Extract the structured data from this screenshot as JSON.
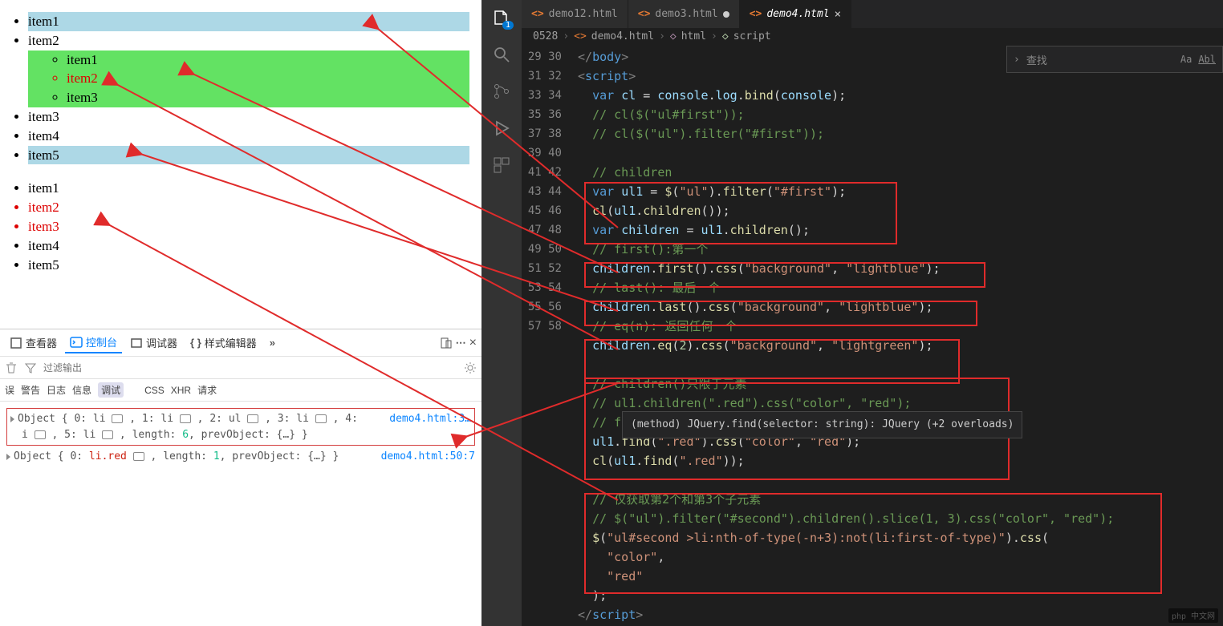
{
  "preview": {
    "list1_items": [
      "item1",
      "item2",
      "item3",
      "item4",
      "item5"
    ],
    "nested_items": [
      "item1",
      "item2",
      "item3"
    ],
    "list2_items": [
      "item1",
      "item2",
      "item3",
      "item4",
      "item5"
    ]
  },
  "devtools": {
    "tabs": {
      "inspector": "查看器",
      "console": "控制台",
      "debugger": "调试器",
      "style": "样式编辑器"
    },
    "filter_placeholder": "过滤输出",
    "sub_left": "误",
    "sub": [
      "警告",
      "日志",
      "信息",
      "调试"
    ],
    "sub2": [
      "CSS",
      "XHR",
      "请求"
    ],
    "obj1_full": "Object { 0: li ▢ , 1: li ▢ , 2: ul ▢ , 3: li ▢ , 4:",
    "obj1_wrap": "i ▢ , 5: li ▢ , length: 6, prevObject: {…} }",
    "obj1_link": "demo4.html:3…",
    "obj2": "Object { 0: li.red ▢ , length: 1, prevObject: {…} }",
    "obj2_link": "demo4.html:50:7"
  },
  "vscode": {
    "badge": "1",
    "tabs": [
      {
        "label": "demo12.html",
        "active": false,
        "dirty": false
      },
      {
        "label": "demo3.html",
        "active": false,
        "dirty": true
      },
      {
        "label": "demo4.html",
        "active": true,
        "dirty": false
      }
    ],
    "breadcrumb": {
      "folder": "0528",
      "file": "demo4.html",
      "el1": "html",
      "el2": "script"
    },
    "find": {
      "placeholder": "查找",
      "case": "Aa",
      "word": "Abl"
    },
    "tooltip": "(method) JQuery.find(selector: string): JQuery (+2 overloads)",
    "code": [
      {
        "n": 29,
        "html": "<span class='k-tag'>&lt;/</span><span class='k-tn'>body</span><span class='k-tag'>&gt;</span>"
      },
      {
        "n": 30,
        "html": "<span class='k-tag'>&lt;</span><span class='k-tn'>script</span><span class='k-tag'>&gt;</span>"
      },
      {
        "n": 31,
        "html": "  <span class='k-blue'>var</span> <span class='k-lb'>cl</span> = <span class='k-lb'>console</span>.<span class='k-lb'>log</span>.<span class='k-fn'>bind</span>(<span class='k-lb'>console</span>);"
      },
      {
        "n": 32,
        "html": "  <span class='k-cmt'>// cl($(\"ul#first\"));</span>"
      },
      {
        "n": 33,
        "html": "  <span class='k-cmt'>// cl($(\"ul\").filter(\"#first\"));</span>"
      },
      {
        "n": 34,
        "html": ""
      },
      {
        "n": 35,
        "html": "  <span class='k-cmt'>// children</span>"
      },
      {
        "n": 36,
        "html": "  <span class='k-blue'>var</span> <span class='k-lb'>ul1</span> = <span class='k-fn'>$</span>(<span class='k-str'>\"ul\"</span>).<span class='k-fn'>filter</span>(<span class='k-str'>\"#first\"</span>);"
      },
      {
        "n": 37,
        "html": "  <span class='k-fn'>cl</span>(<span class='k-lb'>ul1</span>.<span class='k-fn'>children</span>());"
      },
      {
        "n": 38,
        "html": "  <span class='k-blue'>var</span> <span class='k-lb'>children</span> = <span class='k-lb'>ul1</span>.<span class='k-fn'>children</span>();"
      },
      {
        "n": 39,
        "html": "  <span class='k-cmt'>// first():第一个</span>"
      },
      {
        "n": 40,
        "html": "  <span class='k-lb'>children</span>.<span class='k-fn'>first</span>().<span class='k-fn'>css</span>(<span class='k-str'>\"background\"</span>, <span class='k-str'>\"lightblue\"</span>);"
      },
      {
        "n": 41,
        "html": "  <span class='k-cmt'>// last(): 最后一个</span>"
      },
      {
        "n": 42,
        "html": "  <span class='k-lb'>children</span>.<span class='k-fn'>last</span>().<span class='k-fn'>css</span>(<span class='k-str'>\"background\"</span>, <span class='k-str'>\"lightblue\"</span>);"
      },
      {
        "n": 43,
        "html": "  <span class='k-cmt'>// eq(n): 返回任何一个</span>"
      },
      {
        "n": 44,
        "html": "  <span class='k-lb'>children</span>.<span class='k-fn'>eq</span>(<span class='k-num'>2</span>).<span class='k-fn'>css</span>(<span class='k-str'>\"background\"</span>, <span class='k-str'>\"lightgreen\"</span>);"
      },
      {
        "n": 45,
        "html": ""
      },
      {
        "n": 46,
        "html": "  <span class='k-cmt'>// children()只限于元素</span>"
      },
      {
        "n": 47,
        "html": "  <span class='k-cmt'>// ul1.children(\".red\").css(\"color\", \"red\");</span>"
      },
      {
        "n": 48,
        "html": "  <span class='k-cmt'>// f</span>"
      },
      {
        "n": 49,
        "html": "  <span class='k-lb'>ul1</span>.<span class='k-fn'>find</span>(<span class='k-str'>\".red\"</span>).<span class='k-fn'>css</span>(<span class='k-str'>\"color\"</span>, <span class='k-str'>\"red\"</span>);"
      },
      {
        "n": 50,
        "html": "  <span class='k-fn'>cl</span>(<span class='k-lb'>ul1</span>.<span class='k-fn'>find</span>(<span class='k-str'>\".red\"</span>));"
      },
      {
        "n": 51,
        "html": ""
      },
      {
        "n": 52,
        "html": "  <span class='k-cmt'>// 仅获取第2个和第3个子元素</span>"
      },
      {
        "n": 53,
        "html": "  <span class='k-cmt'>// $(\"ul\").filter(\"#second\").children().slice(1, 3).css(\"color\", \"red\");</span>"
      },
      {
        "n": 54,
        "html": "  <span class='k-fn'>$</span>(<span class='k-str'>\"ul#second &gt;li:nth-of-type(-n+3):not(li:first-of-type)\"</span>).<span class='k-fn'>css</span>("
      },
      {
        "n": 55,
        "html": "    <span class='k-str'>\"color\"</span>,"
      },
      {
        "n": 56,
        "html": "    <span class='k-str'>\"red\"</span>"
      },
      {
        "n": 57,
        "html": "  );"
      },
      {
        "n": 58,
        "html": "<span class='k-tag'>&lt;/</span><span class='k-tn'>script</span><span class='k-tag'>&gt;</span>"
      }
    ]
  },
  "watermark": "php 中文网"
}
